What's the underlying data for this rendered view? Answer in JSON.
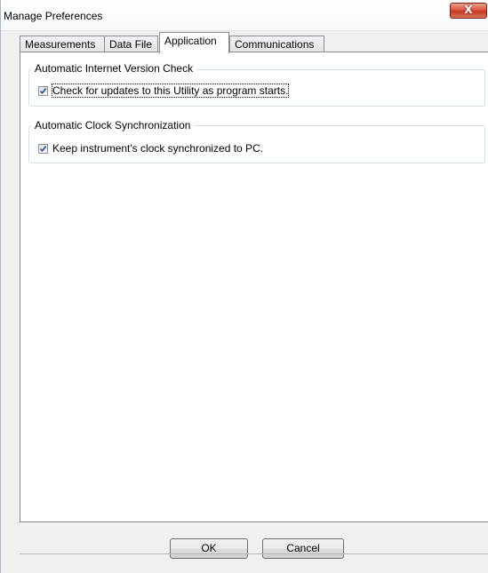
{
  "window": {
    "title": "Manage Preferences",
    "close_glyph": "X"
  },
  "tabs": [
    {
      "label": "Measurements",
      "active": false
    },
    {
      "label": "Data File",
      "active": false
    },
    {
      "label": "Application",
      "active": true
    },
    {
      "label": "Communications",
      "active": false
    }
  ],
  "groups": {
    "version_check": {
      "title": "Automatic Internet Version Check",
      "checkbox_label": "Check for updates to this Utility as program starts.",
      "checked": true
    },
    "clock_sync": {
      "title": "Automatic Clock Synchronization",
      "checkbox_label": "Keep instrument's clock synchronized to PC.",
      "checked": true
    }
  },
  "buttons": {
    "ok": "OK",
    "cancel": "Cancel"
  },
  "colors": {
    "close_button": "#c7432a",
    "check_mark": "#2b4f8a"
  }
}
